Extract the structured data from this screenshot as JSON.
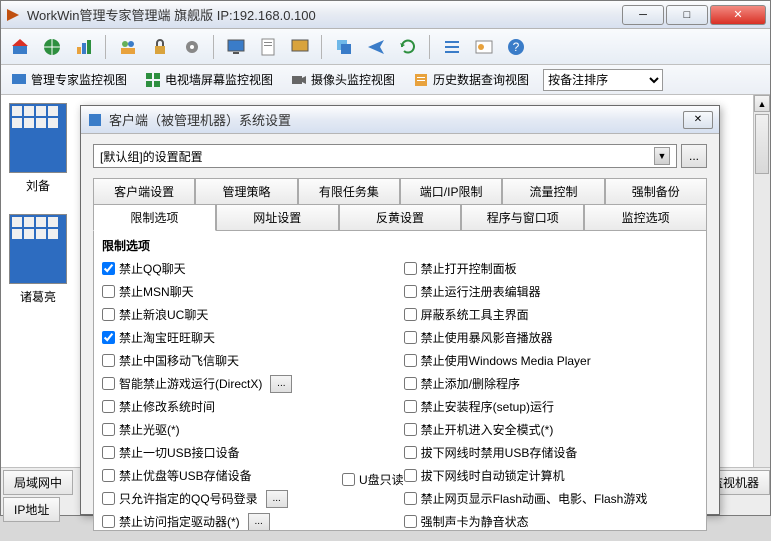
{
  "window": {
    "title": "WorkWin管理专家管理端    旗舰版 IP:192.168.0.100"
  },
  "views": {
    "expert": "管理专家监控视图",
    "videowall": "电视墙屏幕监控视图",
    "camera": "摄像头监控视图",
    "history": "历史数据查询视图",
    "sort_label": "按备注排序"
  },
  "thumbs": {
    "t1": "刘备",
    "t2": "诸葛亮"
  },
  "bottom_tabs": {
    "lan": "局域网中",
    "ip": "IP地址",
    "monitor": "监视机器"
  },
  "dialog": {
    "title": "客户端（被管理机器）系统设置",
    "combo_value": "[默认组]的设置配置",
    "browse": "...",
    "tabs_row1": [
      "客户端设置",
      "管理策略",
      "有限任务集",
      "端口/IP限制",
      "流量控制",
      "强制备份"
    ],
    "tabs_row2": [
      "限制选项",
      "网址设置",
      "反黄设置",
      "程序与窗口项",
      "监控选项"
    ],
    "section_title": "限制选项",
    "left_options": [
      {
        "label": "禁止QQ聊天",
        "checked": true
      },
      {
        "label": "禁止MSN聊天",
        "checked": false
      },
      {
        "label": "禁止新浪UC聊天",
        "checked": false
      },
      {
        "label": "禁止淘宝旺旺聊天",
        "checked": true
      },
      {
        "label": "禁止中国移动飞信聊天",
        "checked": false
      },
      {
        "label": "智能禁止游戏运行(DirectX)",
        "checked": false,
        "btn": true
      },
      {
        "label": "禁止修改系统时间",
        "checked": false
      },
      {
        "label": "禁止光驱(*)",
        "checked": false
      },
      {
        "label": "禁止一切USB接口设备",
        "checked": false
      },
      {
        "label": "禁止优盘等USB存储设备",
        "checked": false
      },
      {
        "label": "只允许指定的QQ号码登录",
        "checked": false,
        "btn": true
      },
      {
        "label": "禁止访问指定驱动器(*)",
        "checked": false,
        "btn": true
      }
    ],
    "right_options": [
      {
        "label": "禁止打开控制面板",
        "checked": false
      },
      {
        "label": "禁止运行注册表编辑器",
        "checked": false
      },
      {
        "label": "屏蔽系统工具主界面",
        "checked": false
      },
      {
        "label": "禁止使用暴风影音播放器",
        "checked": false
      },
      {
        "label": "禁止使用Windows Media Player",
        "checked": false
      },
      {
        "label": "禁止添加/删除程序",
        "checked": false
      },
      {
        "label": "禁止安装程序(setup)运行",
        "checked": false
      },
      {
        "label": "禁止开机进入安全模式(*)",
        "checked": false
      },
      {
        "label": "拔下网线时禁用USB存储设备",
        "checked": false
      },
      {
        "label": "拔下网线时自动锁定计算机",
        "checked": false
      },
      {
        "label": "禁止网页显示Flash动画、电影、Flash游戏",
        "checked": false
      },
      {
        "label": "强制声卡为静音状态",
        "checked": false
      }
    ],
    "u_readonly": "U盘只读"
  }
}
